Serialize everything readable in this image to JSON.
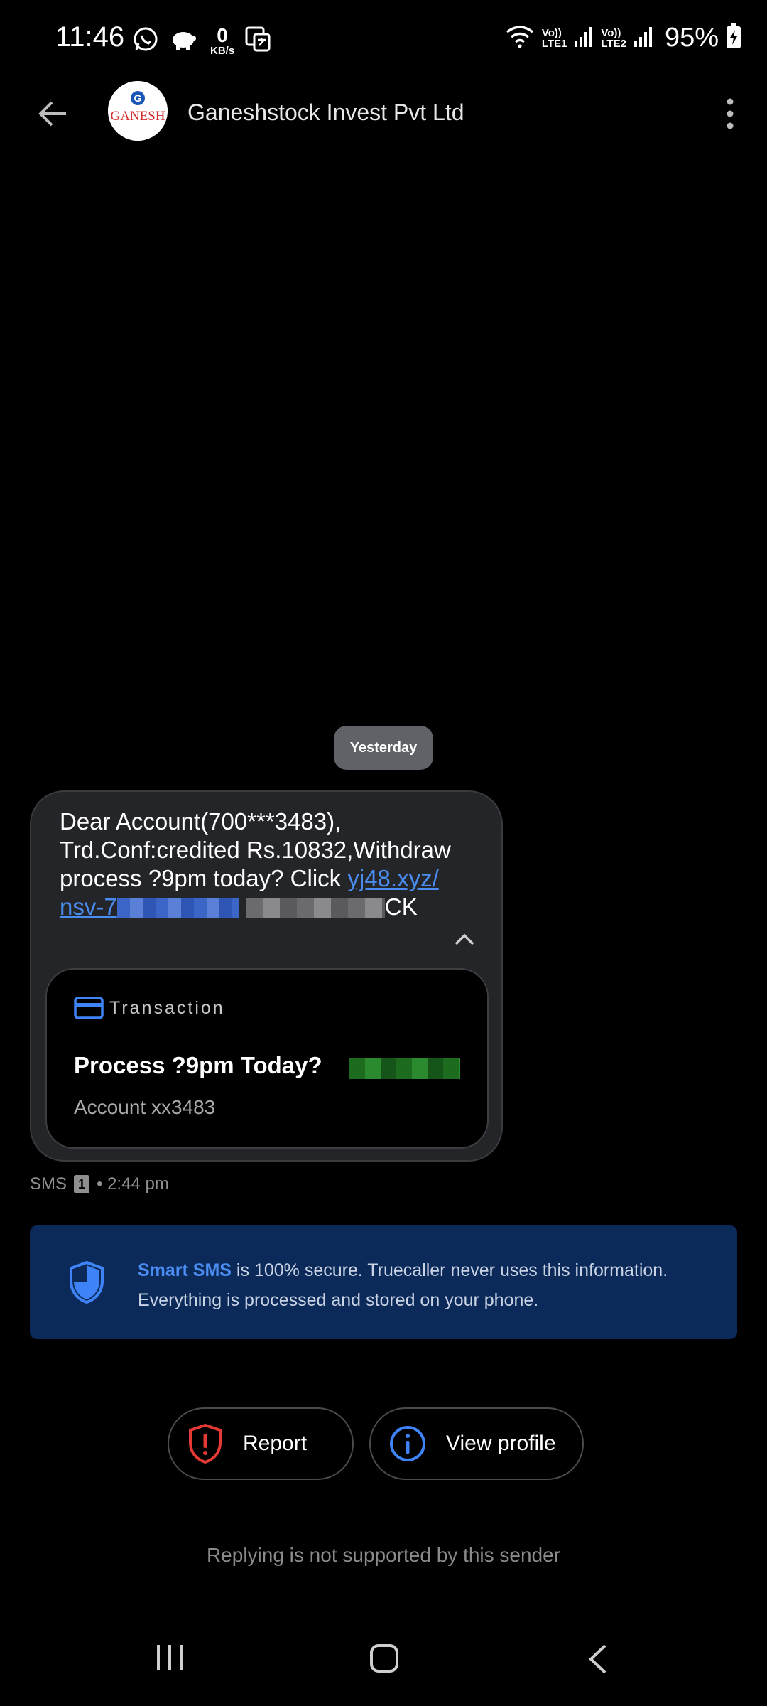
{
  "status_bar": {
    "time": "11:46",
    "data_rate_value": "0",
    "data_rate_unit": "KB/s",
    "sim1_label_top": "Vo))",
    "sim1_label_bottom": "LTE1",
    "sim2_label_top": "Vo))",
    "sim2_label_bottom": "LTE2",
    "battery_percent": "95%",
    "icons": [
      "whatsapp-icon",
      "piggy-bank-icon",
      "translate-icon",
      "wifi-icon",
      "signal-icon",
      "battery-charging-icon"
    ]
  },
  "header": {
    "contact_name": "Ganeshstock Invest Pvt Ltd",
    "avatar_logo_text": "GANESH"
  },
  "conversation": {
    "date_label": "Yesterday",
    "message": {
      "text_before_link": "Dear Account(700***3483), Trd.Conf:credited Rs.10832,Withdraw process ?9pm today? Click ",
      "link_text_visible_1": "yj48.xyz/",
      "link_text_visible_2": "nsv-7",
      "text_after_redaction": "CK",
      "card": {
        "label": "Transaction",
        "title": "Process ?9pm Today?",
        "subtitle": "Account xx3483"
      }
    },
    "meta_channel": "SMS",
    "meta_sim": "1",
    "meta_time": "• 2:44 pm"
  },
  "smart_sms": {
    "brand": "Smart SMS",
    "text": " is 100% secure. Truecaller never uses this information. Everything is processed and stored on your phone."
  },
  "actions": {
    "report_label": "Report",
    "view_profile_label": "View profile"
  },
  "footer": {
    "reply_note": "Replying is not supported by this sender"
  },
  "colors": {
    "background": "#000000",
    "bubble": "#242529",
    "link_blue": "#4a8cf0",
    "banner": "#0b2a5a",
    "report_red": "#e53935"
  }
}
